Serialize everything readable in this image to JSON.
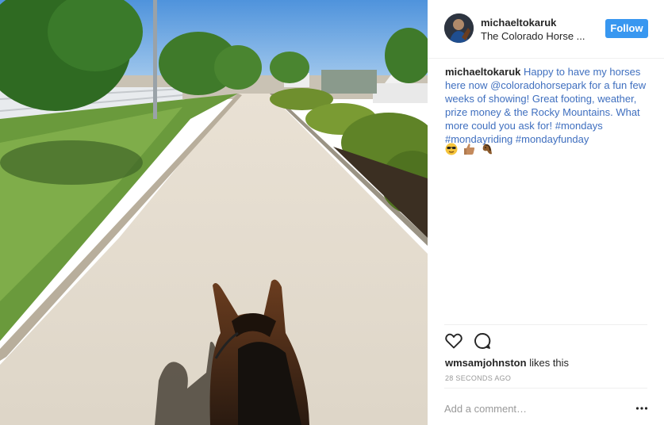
{
  "post": {
    "username": "michaeltokaruk",
    "location": "The Colorado Horse ...",
    "follow_label": "Follow",
    "caption_username": "michaeltokaruk",
    "caption_text": "Happy to have my horses here now @coloradohorsepark for a fun few weeks of showing! Great footing, weather, prize money & the Rocky Mountains. What more could you ask for! #mondays #mondayriding #mondayfunday",
    "caption_emojis": [
      "sunglasses-face",
      "thumbs-up",
      "horse-face"
    ],
    "liker": "wmsamjohnston",
    "likes_suffix": "likes this",
    "timestamp": "28 SECONDS AGO",
    "comment_placeholder": "Add a comment…"
  },
  "icons": {
    "like": "heart-outline-icon",
    "comment": "comment-bubble-icon",
    "more": "more-options-icon"
  },
  "colors": {
    "follow_button": "#3897f0",
    "caption_link": "#3f6fbf",
    "timestamp": "#999999",
    "divider": "#efefef"
  }
}
